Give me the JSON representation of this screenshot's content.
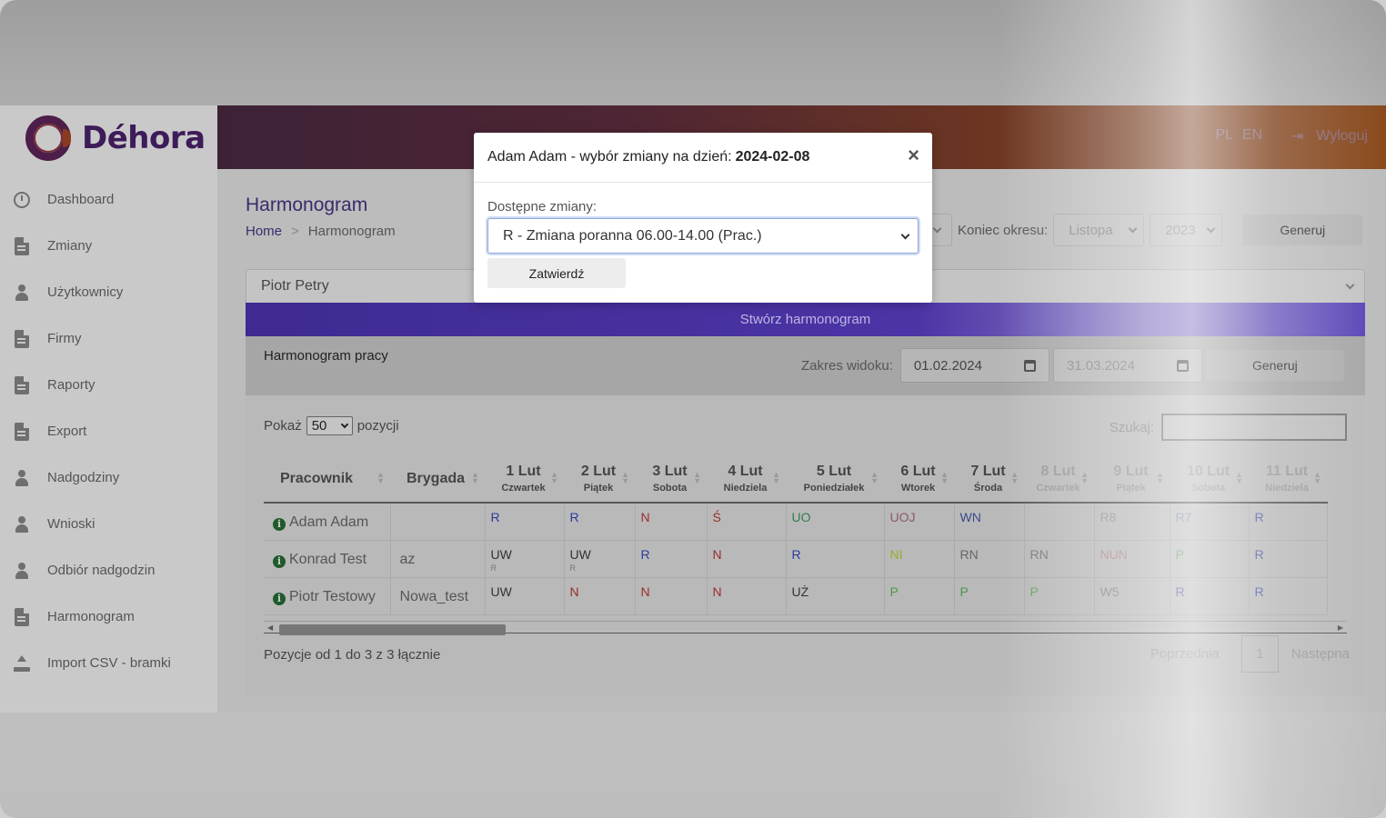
{
  "app": {
    "brand": "Déhora",
    "colors": {
      "primary": "#3b2a6c",
      "accent_button": "#4c34a6",
      "topbar_start": "#3d2236",
      "topbar_end": "#8a4a1d"
    }
  },
  "topbar": {
    "lang_pl": "PL",
    "lang_en": "EN",
    "logout": "Wyloguj",
    "logout_icon": "sign-out-icon"
  },
  "sidebar": {
    "items": [
      {
        "label": "Dashboard",
        "icon": "clock-icon"
      },
      {
        "label": "Zmiany",
        "icon": "document-icon"
      },
      {
        "label": "Użytkownicy",
        "icon": "user-icon"
      },
      {
        "label": "Firmy",
        "icon": "document-icon"
      },
      {
        "label": "Raporty",
        "icon": "document-icon"
      },
      {
        "label": "Export",
        "icon": "document-icon"
      },
      {
        "label": "Nadgodziny",
        "icon": "user-icon"
      },
      {
        "label": "Wnioski",
        "icon": "user-icon"
      },
      {
        "label": "Odbiór nadgodzin",
        "icon": "user-icon"
      },
      {
        "label": "Harmonogram",
        "icon": "document-icon"
      },
      {
        "label": "Import CSV - bramki",
        "icon": "upload-icon"
      }
    ]
  },
  "page": {
    "title": "Harmonogram",
    "breadcrumb": {
      "home": "Home",
      "current": "Harmonogram"
    }
  },
  "period": {
    "end_label": "Koniec okresu:",
    "end_month": "Listopa",
    "end_year": "2023",
    "generate": "Generuj"
  },
  "employee_select": {
    "value": "Piotr Petry"
  },
  "create_button": "Stwórz harmonogram",
  "schedule": {
    "title": "Harmonogram pracy",
    "range_label": "Zakres widoku:",
    "date_from": "01.02.2024",
    "date_to": "31.03.2024",
    "generate": "Generuj",
    "show_prefix": "Pokaż",
    "page_length": "50",
    "show_suffix": "pozycji",
    "search_label": "Szukaj:",
    "search_value": "",
    "columns": {
      "employee": "Pracownik",
      "brigade": "Brygada",
      "days": [
        {
          "day": "1 Lut",
          "weekday": "Czwartek"
        },
        {
          "day": "2 Lut",
          "weekday": "Piątek"
        },
        {
          "day": "3 Lut",
          "weekday": "Sobota"
        },
        {
          "day": "4 Lut",
          "weekday": "Niedziela"
        },
        {
          "day": "5 Lut",
          "weekday": "Poniedziałek"
        },
        {
          "day": "6 Lut",
          "weekday": "Wtorek"
        },
        {
          "day": "7 Lut",
          "weekday": "Środa"
        },
        {
          "day": "8 Lut",
          "weekday": "Czwartek"
        },
        {
          "day": "9 Lut",
          "weekday": "Piątek"
        },
        {
          "day": "10 Lut",
          "weekday": "Sobota"
        },
        {
          "day": "11 Lut",
          "weekday": "Niedziela"
        }
      ]
    },
    "rows": [
      {
        "employee": "Adam Adam",
        "brigade": "",
        "cells": [
          {
            "v": "R",
            "c": "R"
          },
          {
            "v": "R",
            "c": "R"
          },
          {
            "v": "N",
            "c": "N"
          },
          {
            "v": "Ś",
            "c": "S"
          },
          {
            "v": "UO",
            "c": "UO"
          },
          {
            "v": "UOJ",
            "c": "UOJ"
          },
          {
            "v": "WN",
            "c": "WN"
          },
          {
            "v": "",
            "c": ""
          },
          {
            "v": "R8",
            "c": "R8"
          },
          {
            "v": "R7",
            "c": "R7"
          },
          {
            "v": "R",
            "c": "R"
          }
        ]
      },
      {
        "employee": "Konrad Test",
        "brigade": "az",
        "cells": [
          {
            "v": "UW",
            "c": "UW",
            "sub": "R"
          },
          {
            "v": "UW",
            "c": "UW",
            "sub": "R"
          },
          {
            "v": "R",
            "c": "R"
          },
          {
            "v": "N",
            "c": "N"
          },
          {
            "v": "R",
            "c": "R"
          },
          {
            "v": "NI",
            "c": "NI"
          },
          {
            "v": "RN",
            "c": "RN"
          },
          {
            "v": "RN",
            "c": "RN"
          },
          {
            "v": "NUN",
            "c": "NUN"
          },
          {
            "v": "P",
            "c": "P"
          },
          {
            "v": "R",
            "c": "R"
          }
        ]
      },
      {
        "employee": "Piotr Testowy",
        "brigade": "Nowa_test",
        "cells": [
          {
            "v": "UW",
            "c": "UW"
          },
          {
            "v": "N",
            "c": "N"
          },
          {
            "v": "N",
            "c": "N"
          },
          {
            "v": "N",
            "c": "N"
          },
          {
            "v": "UŻ",
            "c": "UZ"
          },
          {
            "v": "P",
            "c": "P"
          },
          {
            "v": "P",
            "c": "P"
          },
          {
            "v": "P",
            "c": "P"
          },
          {
            "v": "W5",
            "c": "W5"
          },
          {
            "v": "R",
            "c": "R"
          },
          {
            "v": "R",
            "c": "R"
          }
        ]
      }
    ],
    "info": "Pozycje od 1 do 3 z 3 łącznie",
    "pager": {
      "prev": "Poprzednia",
      "page": "1",
      "next": "Następna"
    }
  },
  "modal": {
    "title_prefix": "Adam Adam - wybór zmiany na dzień:",
    "title_date": "2024-02-08",
    "close": "×",
    "field_label": "Dostępne zmiany:",
    "selected_shift": "R - Zmiana poranna 06.00-14.00 (Prac.)",
    "confirm": "Zatwierdź"
  }
}
